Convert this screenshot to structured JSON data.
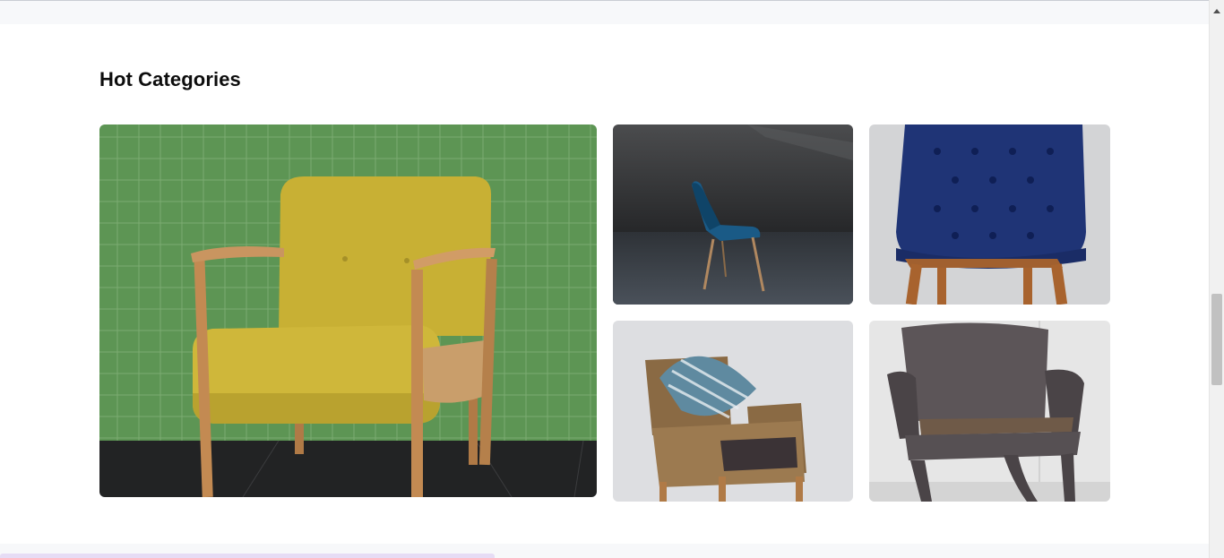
{
  "section": {
    "title": "Hot Categories"
  },
  "categories": [
    {
      "image": "yellow-armchair-image"
    },
    {
      "image": "blue-chair-image"
    },
    {
      "image": "tufted-chair-image"
    },
    {
      "image": "rattan-chair-image"
    },
    {
      "image": "wicker-chair-image"
    }
  ],
  "colors": {
    "page_background": "#ffffff",
    "strip_background": "#f7f8fa",
    "title_text": "#0d0d0d",
    "bottom_accent": "#e6dcf5"
  }
}
